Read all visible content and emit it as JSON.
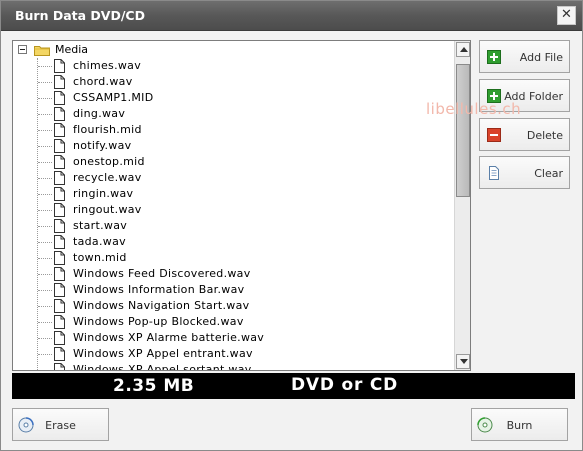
{
  "window": {
    "title": "Burn Data DVD/CD",
    "close_glyph": "✕"
  },
  "tree": {
    "root": {
      "label": "Media",
      "icon": "folder-icon",
      "expander": "collapse"
    },
    "items": [
      "chimes.wav",
      "chord.wav",
      "CSSAMP1.MID",
      "ding.wav",
      "flourish.mid",
      "notify.wav",
      "onestop.mid",
      "recycle.wav",
      "ringin.wav",
      "ringout.wav",
      "start.wav",
      "tada.wav",
      "town.mid",
      "Windows Feed Discovered.wav",
      "Windows Information Bar.wav",
      "Windows Navigation Start.wav",
      "Windows Pop-up Blocked.wav",
      "Windows XP Alarme batterie.wav",
      "Windows XP Appel entrant.wav",
      "Windows XP Appel sortant.wav"
    ]
  },
  "side_buttons": {
    "add_file": "Add File",
    "add_folder": "Add Folder",
    "delete": "Delete",
    "clear": "Clear"
  },
  "watermark": "libellules.ch",
  "status": {
    "size": "2.35 MB",
    "media": "DVD or CD"
  },
  "bottom_buttons": {
    "erase": "Erase",
    "burn": "Burn"
  },
  "colors": {
    "titlebar": "#585858",
    "status_bar": "#000000",
    "add_icon": "#2f9e2f",
    "delete_icon": "#d9432b",
    "watermark": "#f2b8ab"
  }
}
